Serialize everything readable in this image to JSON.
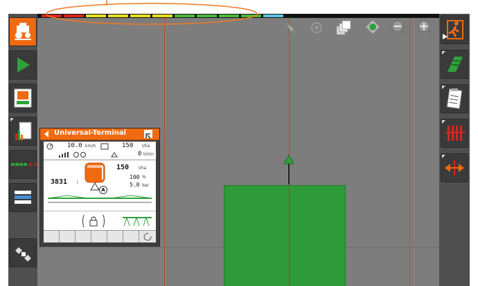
{
  "colors": {
    "accent": "#f06a10",
    "field_green": "#2e9a3a",
    "guidance_line": "#c8302a",
    "background": "#7d7d7d"
  },
  "status_strip": {
    "segments": [
      "#d7261e",
      "#d7261e",
      "#e8e020",
      "#e8e020",
      "#e8e020",
      "#e8e020",
      "#4cb83c",
      "#4cb83c",
      "#4cb83c",
      "#4cb83c",
      "#5cc6d8"
    ]
  },
  "left_toolbar": {
    "items": [
      "tractor-home-icon",
      "play-icon",
      "implement-icon",
      "clipboard-chart-icon",
      "section-control-icon",
      "layers-list-icon",
      "satellite-icon"
    ]
  },
  "right_toolbar": {
    "items": [
      "exit-run-icon",
      "field-stripes-icon",
      "notes-icon",
      "tramline-icon",
      "swap-arrows-icon"
    ]
  },
  "map_toolbar": {
    "items": [
      "headland-icon",
      "target-icon",
      "layers-icon",
      "center-icon",
      "zoom-out-icon",
      "zoom-in-icon"
    ]
  },
  "terminal": {
    "title": "Universal-Terminal",
    "speed": "10.0",
    "speed_unit": "km/h",
    "rate_top": "150",
    "rate_top_unit": "l/ha",
    "flow": "0",
    "flow_unit": "l/min",
    "app_rate": "150",
    "app_rate_unit": "l/ha",
    "percent": "100",
    "percent_unit": "%",
    "pressure": "5.0",
    "pressure_unit": "bar",
    "tank": "3831",
    "tank_unit": "l",
    "tank_label": "A"
  }
}
